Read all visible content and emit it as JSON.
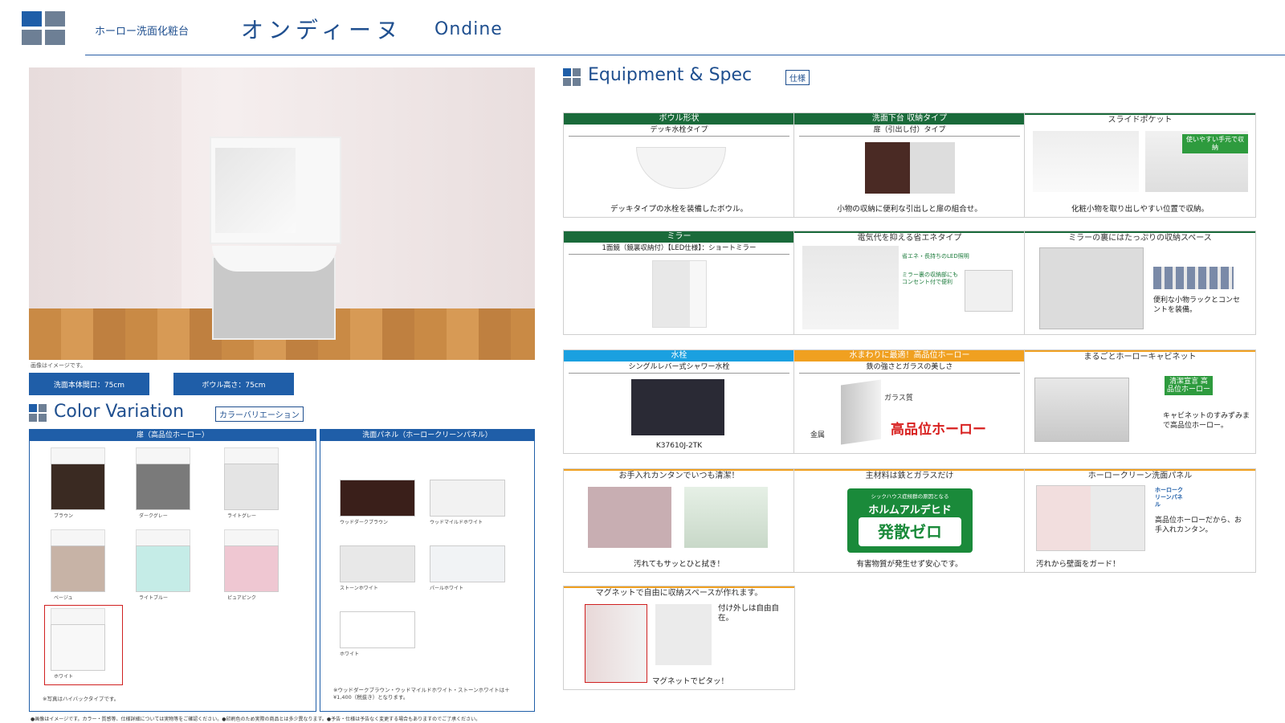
{
  "header": {
    "category": "ホーロー洗面化粧台",
    "title_jp": "オンディーヌ",
    "title_en": "Ondine"
  },
  "photo": {
    "caption": "画像はイメージです。",
    "dims": [
      "洗面本体間口：75cm",
      "ボウル高さ：75cm"
    ]
  },
  "color_variation": {
    "title": "Color Variation",
    "tag": "カラーバリエーション",
    "door_header": "扉（高品位ホーロー）",
    "panel_header": "洗面パネル（ホーロークリーンパネル）",
    "doors": [
      {
        "name": "ブラウン",
        "color": "#3a2a22"
      },
      {
        "name": "ダークグレー",
        "color": "#7a7a7a"
      },
      {
        "name": "ライトグレー",
        "color": "#e4e4e4"
      },
      {
        "name": "ベージュ",
        "color": "#c7b3a6"
      },
      {
        "name": "ライトブルー",
        "color": "#c5ece7"
      },
      {
        "name": "ピュアピンク",
        "color": "#efc7d2"
      },
      {
        "name": "ホワイト",
        "color": "#f8f8f8"
      }
    ],
    "door_note": "※写真はハイバックタイプです。",
    "panels": [
      {
        "name": "ウッドダークブラウン",
        "color": "#3a1f1a"
      },
      {
        "name": "ウッドマイルドホワイト",
        "color": "#f2f2f2"
      },
      {
        "name": "ストーンホワイト",
        "color": "#e8e8e8"
      },
      {
        "name": "パールホワイト",
        "color": "#f1f3f5"
      },
      {
        "name": "ホワイト",
        "color": "#ffffff"
      }
    ],
    "panel_note": "※ウッドダークブラウン・ウッドマイルドホワイト・ストーンホワイトは＋¥1,400（税抜き）となります。"
  },
  "equipment": {
    "title": "Equipment & Spec",
    "tag": "仕様",
    "cards": [
      {
        "head": "ボウル形状",
        "sub": "デッキ水栓タイプ",
        "cap": "デッキタイプの水栓を装備したボウル。"
      },
      {
        "head": "洗面下台 収納タイプ",
        "sub": "扉（引出し付）タイプ",
        "cap": "小物の収納に便利な引出しと扉の組合せ。"
      },
      {
        "head": "スライドポケット",
        "cap": "化粧小物を取り出しやすい位置で収納。",
        "badge": "使いやすい手元で収納"
      },
      {
        "head": "ミラー",
        "sub": "1面鏡（鏡裏収納付）【LED仕様】：ショートミラー"
      },
      {
        "head": "電気代を抑える省エネタイプ",
        "note1": "省エネ・長持ちのLED照明",
        "note2": "ミラー裏の収納部にもコンセント付で便利"
      },
      {
        "head": "ミラーの裏にはたっぷりの収納スペース",
        "note": "便利な小物ラックとコンセントを装備。"
      },
      {
        "head": "水栓",
        "sub": "シングルレバー式シャワー水栓",
        "cap": "K37610J-2TK"
      },
      {
        "head": "水まわりに最適！高品位ホーロー",
        "sub": "鉄の強さとガラスの美しさ",
        "glass": "ガラス質",
        "metal": "金属",
        "big": "高品位ホーロー"
      },
      {
        "head": "まるごとホーローキャビネット",
        "badge": "清潔宣言 高品位ホーロー",
        "note": "キャビネットのすみずみまで高品位ホーロー。"
      },
      {
        "head": "お手入れカンタンでいつも清潔！",
        "cap": "汚れてもサッとひと拭き！"
      },
      {
        "head": "主材料は鉄とガラスだけ",
        "badge1": "シックハウス症候群の原因となる",
        "badge2": "ホルムアルデヒド",
        "badge3": "発散ゼロ",
        "cap": "有害物質が発生せず安心です。"
      },
      {
        "head": "ホーロークリーン洗面パネル",
        "badge": "ホーロークリーンパネル",
        "note": "高品位ホーローだから、お手入れカンタン。",
        "cap": "汚れから壁面をガード！"
      },
      {
        "head": "マグネットで自由に収納スペースが作れます。",
        "note": "付け外しは自由自在。",
        "cap": "マグネットでピタッ！"
      }
    ]
  },
  "footer": "●画像はイメージです。カラー・質感等、仕様詳細については実物等をご確認ください。●印刷色のため実際の商品とは多少異なります。●予告・仕様は予告なく変更する場合もありますのでご了承ください。"
}
